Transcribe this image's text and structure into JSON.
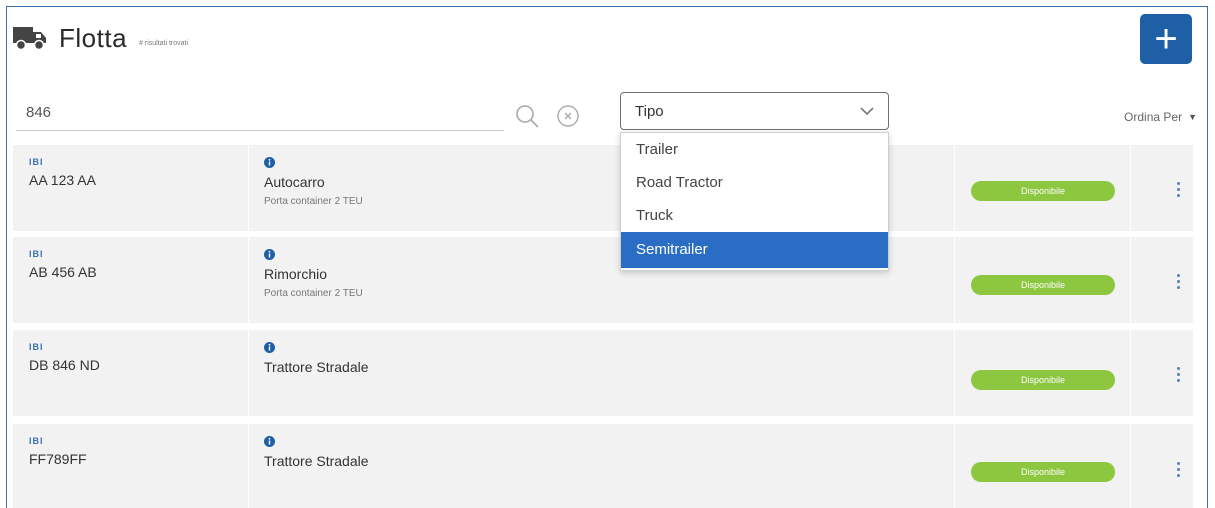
{
  "header": {
    "title": "Flotta",
    "subtitle": "# risultati trovati"
  },
  "search": {
    "value": "846",
    "placeholder": ""
  },
  "type_select": {
    "label": "Tipo",
    "options": [
      "Trailer",
      "Road Tractor",
      "Truck",
      "Semitrailer"
    ],
    "highlighted": "Semitrailer"
  },
  "sort": {
    "label": "Ordina Per"
  },
  "vehicles": [
    {
      "flag": "IBI",
      "plate": "AA 123 AA",
      "type": "Autocarro",
      "description": "Porta container 2 TEU",
      "status": "Disponibile"
    },
    {
      "flag": "IBI",
      "plate": "AB 456 AB",
      "type": "Rimorchio",
      "description": "Porta container 2 TEU",
      "status": "Disponibile"
    },
    {
      "flag": "IBI",
      "plate": "DB 846 ND",
      "type": "Trattore Stradale",
      "description": "",
      "status": "Disponibile"
    },
    {
      "flag": "IBI",
      "plate": "FF789FF",
      "type": "Trattore Stradale",
      "description": "",
      "status": "Disponibile"
    }
  ],
  "colors": {
    "primary": "#1f5fa6",
    "status_available": "#8dc63f",
    "highlight": "#2a6dc4",
    "row_bg": "#f2f2f2"
  }
}
